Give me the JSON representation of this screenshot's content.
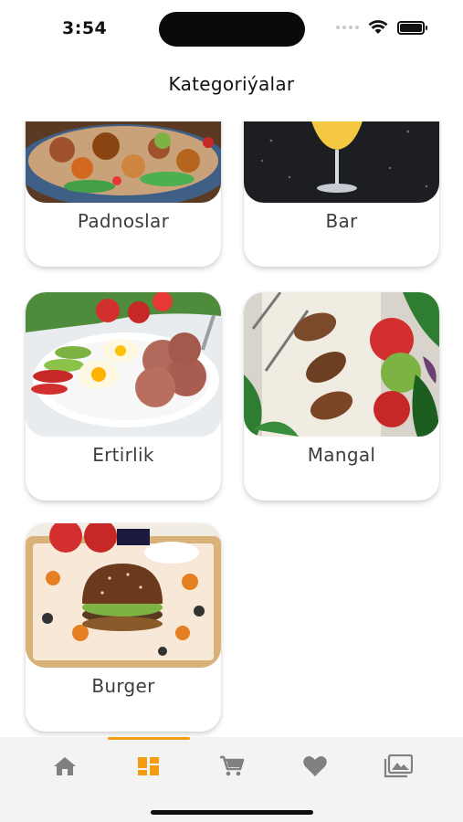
{
  "status_bar": {
    "time": "3:54",
    "icons": [
      "signal-icon",
      "wifi-icon",
      "battery-icon"
    ]
  },
  "header": {
    "title": "Kategoriýalar"
  },
  "categories": [
    {
      "label": "Padnoslar",
      "image": "food-platter-photo"
    },
    {
      "label": "Bar",
      "image": "drink-glass-photo"
    },
    {
      "label": "Ertirlik",
      "image": "breakfast-plate-photo"
    },
    {
      "label": "Mangal",
      "image": "kebab-grill-photo"
    },
    {
      "label": "Burger",
      "image": "burger-tray-photo"
    }
  ],
  "tab_bar": {
    "active_index": 1,
    "accent_color": "#f39c12",
    "inactive_color": "#808080",
    "tabs": [
      {
        "icon": "home-icon"
      },
      {
        "icon": "categories-grid-icon"
      },
      {
        "icon": "cart-icon"
      },
      {
        "icon": "heart-icon"
      },
      {
        "icon": "gallery-icon"
      }
    ]
  }
}
